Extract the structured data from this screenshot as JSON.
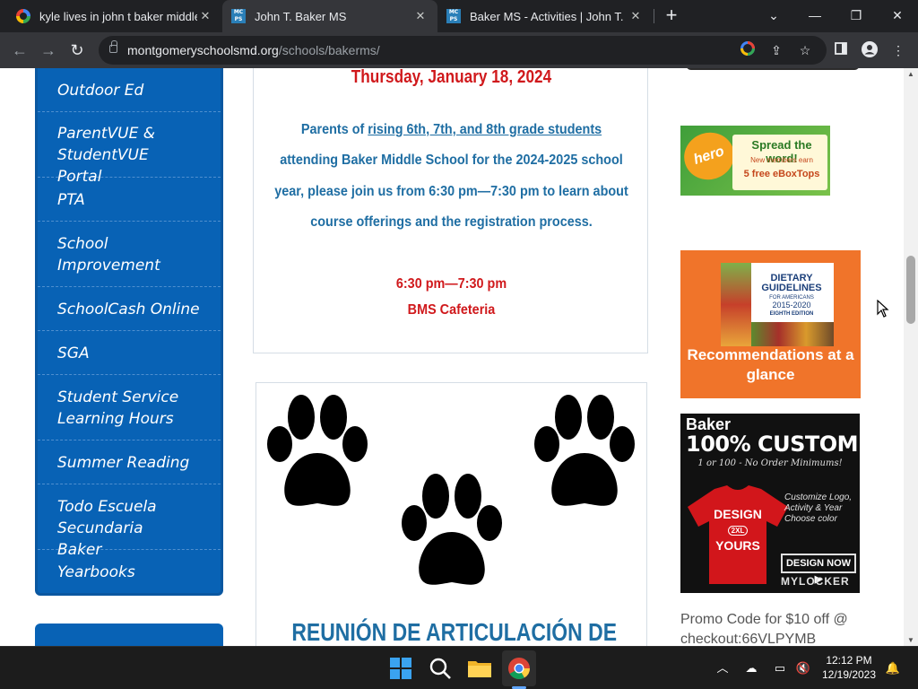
{
  "browser": {
    "tabs": [
      {
        "title": "kyle lives in john t baker middle s",
        "icon": "google-icon"
      },
      {
        "title": "John T. Baker MS",
        "icon": "mcps-icon",
        "active": true
      },
      {
        "title": "Baker MS - Activities | John T. Bak",
        "icon": "mcps-icon"
      }
    ],
    "url_domain": "montgomeryschoolsmd.org",
    "url_path": "/schools/bakerms/",
    "window_controls": {
      "tab_search": "⌄",
      "minimize": "—",
      "restore": "❐",
      "close": "✕"
    }
  },
  "sidebar": {
    "items": [
      {
        "label": "Outdoor Ed"
      },
      {
        "label": "ParentVUE & StudentVUE Portal"
      },
      {
        "label": "PTA"
      },
      {
        "label": "School Improvement"
      },
      {
        "label": "SchoolCash Online"
      },
      {
        "label": "SGA"
      },
      {
        "label": "Student Service Learning Hours"
      },
      {
        "label": "Summer Reading"
      },
      {
        "label": "Todo Escuela Secundaria Baker"
      },
      {
        "label": "Yearbooks"
      }
    ]
  },
  "event": {
    "date": "Thursday, January 18, 2024",
    "line1_prefix": "Parents of ",
    "line1_link": "rising 6th, 7th, and 8th grade students",
    "line2": "attending Baker Middle School for the 2024-2025 school",
    "line3": "year, please join us from 6:30 pm—7:30 pm to learn about",
    "line4": "course offerings and the registration process.",
    "time": "6:30 pm—7:30 pm",
    "location": "BMS Cafeteria"
  },
  "spanish_event": {
    "heading": "REUNIÓN DE ARTICULACIÓN DE"
  },
  "ads": {
    "hero": {
      "badge": "hero",
      "headline": "Spread the word!",
      "sub": "New members earn",
      "offer": "5 free eBoxTops"
    },
    "dietary": {
      "title": "DIETARY",
      "subtitle": "GUIDELINES",
      "audience": "FOR AMERICANS",
      "years": "2015-2020",
      "edition": "EIGHTH EDITION",
      "caption": "Recommendations at a glance"
    },
    "shirt": {
      "brand": "Baker",
      "headline": "100% CUSTOM",
      "tagline": "1 or 100 - No Order Minimums!",
      "shirt_text_1": "DESIGN",
      "shirt_text_2": "YOURS",
      "shirt_badge": "2XL",
      "features": "Customize Logo, Activity & Year",
      "color_note": "Choose color",
      "cta": "DESIGN NOW ▶",
      "footer": "MYLOCKER"
    },
    "promo_text": "Promo Code for $10 off @ checkout:66VLPYMB"
  },
  "taskbar": {
    "time": "12:12 PM",
    "date": "12/19/2023"
  },
  "colors": {
    "sidebar_blue": "#0862b5",
    "event_red": "#d0191c",
    "event_blue": "#1f6ea3"
  }
}
